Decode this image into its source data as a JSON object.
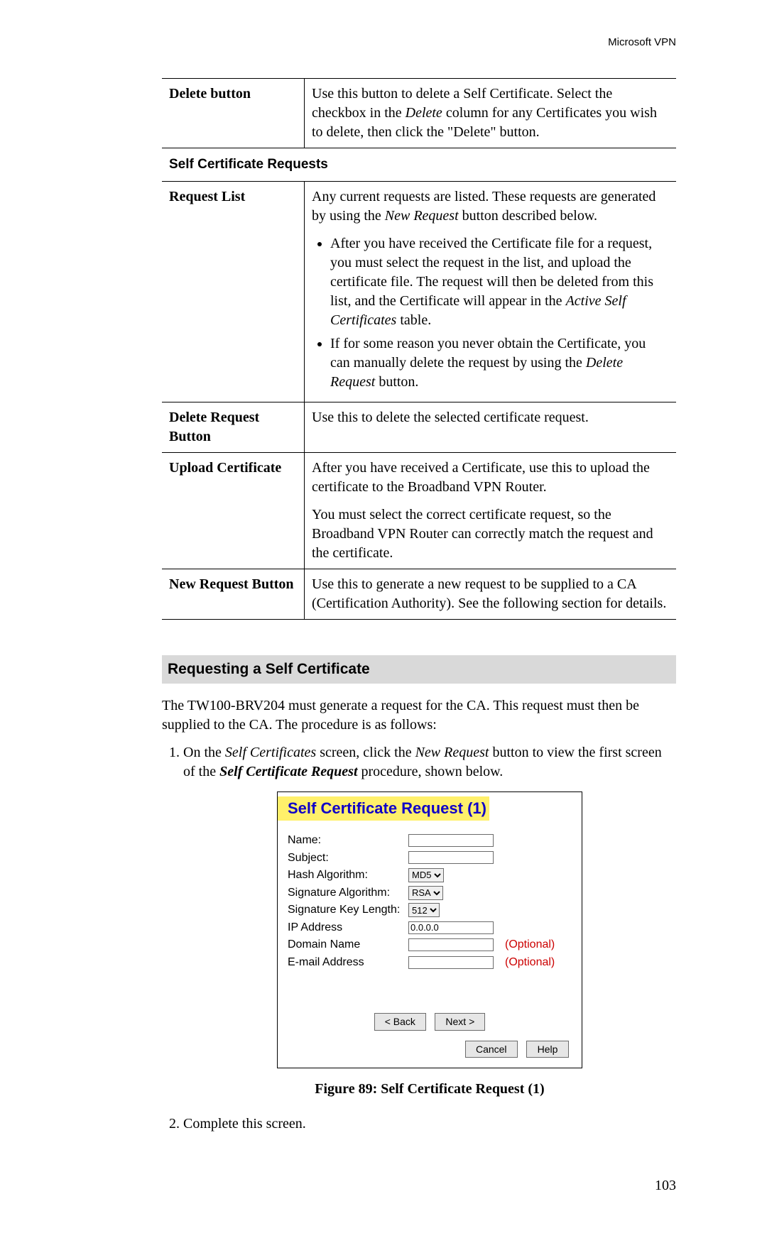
{
  "header": {
    "right": "Microsoft VPN"
  },
  "table": {
    "row1": {
      "label": "Delete button",
      "p1a": "Use this button to delete a Self Certificate. Select the checkbox in the ",
      "p1b": "Delete",
      "p1c": " column for any Certificates you wish to delete, then click the \"Delete\" button."
    },
    "section_head": "Self Certificate Requests",
    "row2": {
      "label": "Request List",
      "p1a": "Any current requests are listed. These requests are generated by using the ",
      "p1b": "New Request",
      "p1c": " button described below.",
      "b1a": "After you have received the Certificate file for a request, you must select the request in the list, and upload the certificate file. The request will then be deleted from this list, and the Certificate will appear in the ",
      "b1b": "Active Self Certificates",
      "b1c": " table.",
      "b2a": "If for some reason you never obtain the Certificate, you can manually delete the request by using the ",
      "b2b": "Delete Request",
      "b2c": " button."
    },
    "row3": {
      "label": "Delete Request Button",
      "p1": "Use this to delete the selected certificate request."
    },
    "row4": {
      "label": "Upload Certificate",
      "p1": "After you have received a Certificate, use this to upload the certificate to the Broadband VPN Router.",
      "p2": "You must select the correct certificate request, so the Broadband VPN Router can correctly match the request and the certificate."
    },
    "row5": {
      "label": "New Request Button",
      "p1": "Use this to generate a new request to be supplied to a CA (Certification Authority). See the following section for details."
    }
  },
  "section": {
    "heading": "Requesting a Self Certificate",
    "intro": "The TW100-BRV204  must generate a request for the CA. This request must then be supplied to the CA. The procedure is as follows:",
    "step1a": "On the ",
    "step1b": "Self Certificates",
    "step1c": " screen, click the ",
    "step1d": "New Request",
    "step1e": " button to view the first screen of the ",
    "step1f": "Self Certificate Request",
    "step1g": " procedure, shown below.",
    "step2": "Complete this screen."
  },
  "dialog": {
    "title": "Self Certificate Request (1)",
    "labels": {
      "name": "Name:",
      "subject": "Subject:",
      "hash": "Hash Algorithm:",
      "sigalg": "Signature Algorithm:",
      "keylen": "Signature Key Length:",
      "ip": "IP Address",
      "domain": "Domain Name",
      "email": "E-mail Address"
    },
    "values": {
      "hash": "MD5",
      "sigalg": "RSA",
      "keylen": "512",
      "ip": "0.0.0.0"
    },
    "optional": "(Optional)",
    "buttons": {
      "back": "< Back",
      "next": "Next >",
      "cancel": "Cancel",
      "help": "Help"
    }
  },
  "figure_caption": "Figure 89: Self Certificate Request (1)",
  "page_number": "103"
}
